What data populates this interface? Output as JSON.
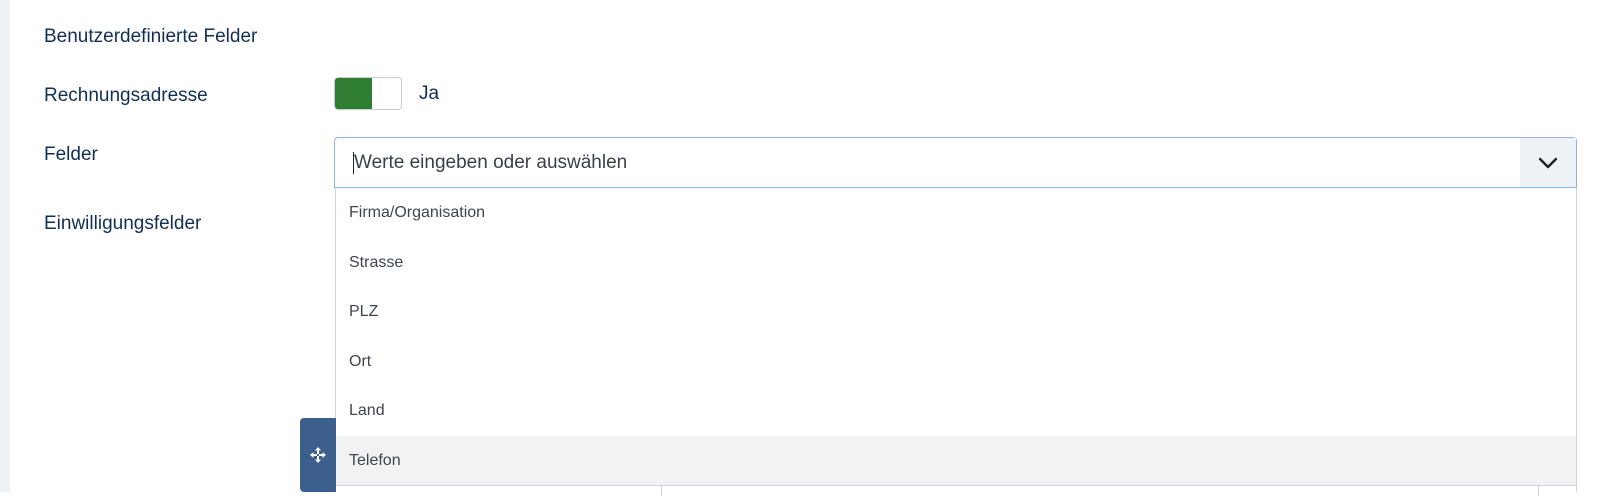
{
  "form": {
    "custom_fields_label": "Benutzerdefinierte Felder",
    "billing_address_label": "Rechnungsadresse",
    "billing_toggle_value": "Ja",
    "fields_label": "Felder",
    "consent_fields_label": "Einwilligungsfelder",
    "fields_select": {
      "placeholder": "Werte eingeben oder auswählen",
      "value": "",
      "icon": "chevron-down-icon",
      "options": [
        {
          "label": "Firma/Organisation"
        },
        {
          "label": "Strasse"
        },
        {
          "label": "PLZ"
        },
        {
          "label": "Ort"
        },
        {
          "label": "Land"
        },
        {
          "label": "Telefon",
          "highlighted": true
        }
      ]
    },
    "move_handle_icon": "move-icon"
  },
  "colors": {
    "toggle_on": "#2e7d32",
    "label_text": "#132f53",
    "select_border_focus": "#8fb2e0",
    "move_handle_bg": "#3c5f8e",
    "option_highlight": "#f2f2f2"
  }
}
